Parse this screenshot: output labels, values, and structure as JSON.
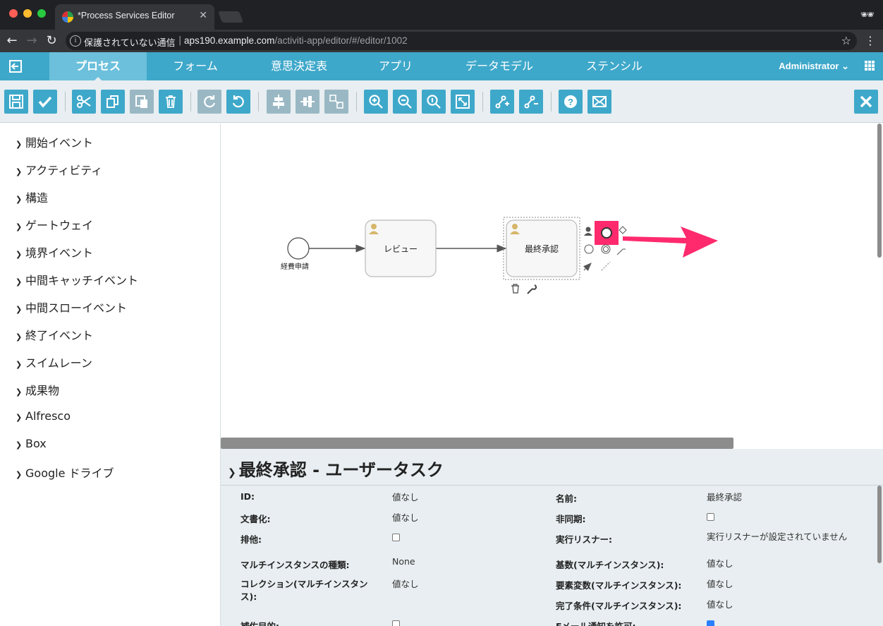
{
  "browser": {
    "tab_title": "*Process Services Editor",
    "security_label": "保護されていない通信",
    "url_host": "aps190.example.com",
    "url_path": "/activiti-app/editor/#/editor/1002"
  },
  "nav": {
    "items": [
      {
        "label": "プロセス",
        "active": true
      },
      {
        "label": "フォーム"
      },
      {
        "label": "意思決定表"
      },
      {
        "label": "アプリ"
      },
      {
        "label": "データモデル"
      },
      {
        "label": "ステンシル"
      }
    ],
    "user": "Administrator"
  },
  "palette": {
    "items": [
      "開始イベント",
      "アクティビティ",
      "構造",
      "ゲートウェイ",
      "境界イベント",
      "中間キャッチイベント",
      "中間スローイベント",
      "終了イベント",
      "スイムレーン",
      "成果物",
      "Alfresco",
      "Box",
      "Google ドライブ"
    ]
  },
  "diagram": {
    "start_label": "経費申請",
    "task1_label": "レビュー",
    "task2_label": "最終承認",
    "accent_color": "#ff2a6d"
  },
  "properties": {
    "title": "最終承認 - ユーザータスク",
    "left": [
      {
        "label": "ID:",
        "value": "値なし"
      },
      {
        "label": "文書化:",
        "value": "値なし"
      },
      {
        "label": "排他:",
        "value": "",
        "checkbox": false
      },
      {
        "label": "マルチインスタンスの種類:",
        "value": "None"
      },
      {
        "label": "コレクション(マルチインスタンス):",
        "value": "値なし"
      },
      {
        "label": "補佐目的:",
        "value": "",
        "checkbox": false
      }
    ],
    "right": [
      {
        "label": "名前:",
        "value": "最終承認"
      },
      {
        "label": "非同期:",
        "value": "",
        "checkbox": false
      },
      {
        "label": "実行リスナー:",
        "value": "実行リスナーが設定されていません"
      },
      {
        "label": "基数(マルチインスタンス):",
        "value": "値なし"
      },
      {
        "label": "要素変数(マルチインスタンス):",
        "value": "値なし"
      },
      {
        "label": "完了条件(マルチインスタンス):",
        "value": "値なし"
      },
      {
        "label": "Eメール通知を許可:",
        "value": "",
        "checkbox": true
      }
    ]
  }
}
